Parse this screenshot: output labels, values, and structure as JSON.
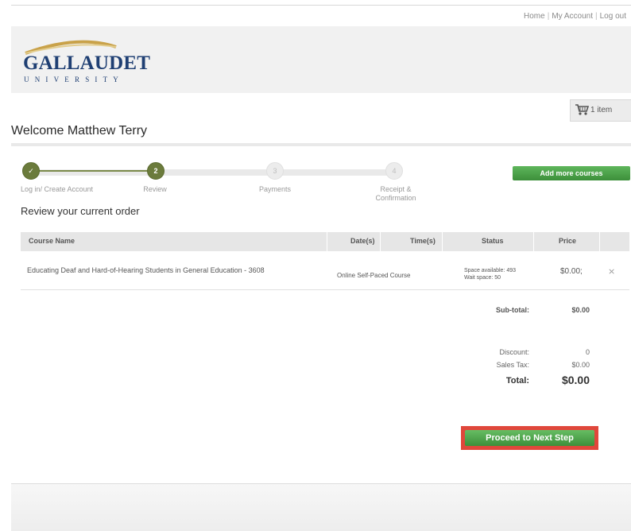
{
  "top_links": {
    "home": "Home",
    "my_account": "My Account",
    "log_out": "Log out"
  },
  "logo": {
    "name": "GALLAUDET",
    "sub": "UNIVERSITY"
  },
  "cart": {
    "icon": "shopping-cart-icon",
    "label": "1 item"
  },
  "welcome": "Welcome Matthew Terry",
  "steps": [
    {
      "number": "✓",
      "label": "Log in/ Create Account",
      "state": "done"
    },
    {
      "number": "2",
      "label": "Review",
      "state": "active"
    },
    {
      "number": "3",
      "label": "Payments",
      "state": "todo"
    },
    {
      "number": "4",
      "label_line1": "Receipt &",
      "label_line2": "Confirmation",
      "state": "todo"
    }
  ],
  "add_more_courses": "Add more courses",
  "review_title": "Review your current order",
  "table": {
    "headers": {
      "course_name": "Course Name",
      "dates": "Date(s)",
      "times": "Time(s)",
      "status": "Status",
      "price": "Price"
    },
    "rows": [
      {
        "course_name": "Educating Deaf and Hard-of-Hearing Students in General Education - 3608",
        "date_time": "Online Self-Paced Course",
        "status_line1": "Space available: 493",
        "status_line2": "Wait space: 50",
        "price": "$0.00;",
        "remove_icon": "remove-x-icon"
      }
    ]
  },
  "totals": {
    "subtotal_label": "Sub-total:",
    "subtotal_value": "$0.00",
    "discount_label": "Discount:",
    "discount_value": "0",
    "sales_tax_label": "Sales Tax:",
    "sales_tax_value": "$0.00",
    "total_label": "Total:",
    "total_value": "$0.00"
  },
  "proceed_button": "Proceed to Next Step",
  "colors": {
    "brand_navy": "#1f3f73",
    "brand_gold": "#c9a24a",
    "button_green": "#4aa347",
    "highlight_red": "#e0473b",
    "step_olive": "#6b7b3c"
  }
}
